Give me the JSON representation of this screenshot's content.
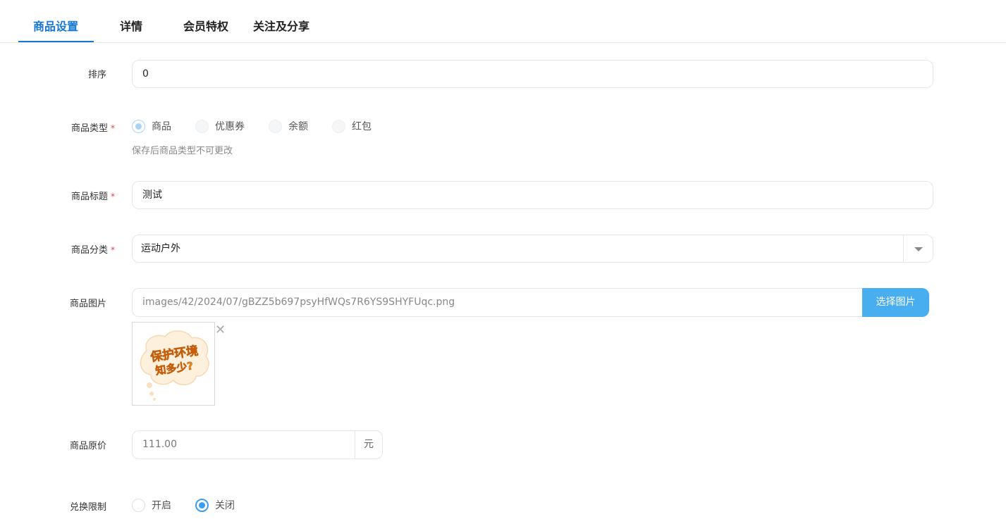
{
  "tabs": [
    {
      "label": "商品设置",
      "active": true
    },
    {
      "label": "详情",
      "active": false
    },
    {
      "label": "会员特权",
      "active": false
    },
    {
      "label": "关注及分享",
      "active": false
    }
  ],
  "form": {
    "sort": {
      "label": "排序",
      "value": "0"
    },
    "type": {
      "label": "商品类型",
      "required_mark": "*",
      "options": [
        "商品",
        "优惠券",
        "余额",
        "红包"
      ],
      "selected": "商品",
      "hint": "保存后商品类型不可更改"
    },
    "title": {
      "label": "商品标题",
      "required_mark": "*",
      "value": "测试"
    },
    "category": {
      "label": "商品分类",
      "required_mark": "*",
      "value": "运动户外"
    },
    "image": {
      "label": "商品图片",
      "path": "images/42/2024/07/gBZZ5b697psyHfWQs7R6YS9SHYFUqc.png",
      "button_label": "选择图片",
      "thumbnail_text_line1": "保护环境",
      "thumbnail_text_line2": "知多少?",
      "remove_symbol": "✕"
    },
    "price": {
      "label": "商品原价",
      "value": "111.00",
      "unit": "元"
    },
    "exchange_limit": {
      "label": "兑换限制",
      "options": [
        "开启",
        "关闭"
      ],
      "selected": "关闭"
    }
  },
  "colors": {
    "accent": "#1677d2",
    "button": "#49aef0",
    "required": "#e04545",
    "radio_checked": "#3a9ef0"
  }
}
